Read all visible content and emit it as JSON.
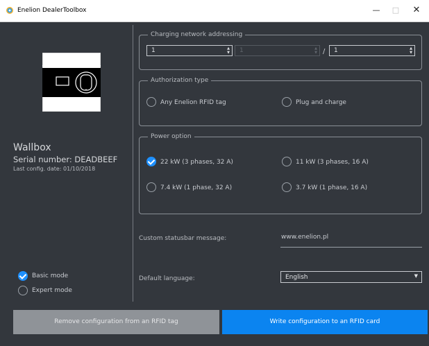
{
  "window": {
    "title": "Enelion DealerToolbox"
  },
  "device": {
    "name": "Wallbox",
    "serial": "Serial number: DEADBEEF",
    "last_config": "Last config. date: 01/10/2018"
  },
  "mode": {
    "basic": "Basic mode",
    "expert": "Expert mode",
    "selected": "basic"
  },
  "network": {
    "title": "Charging network addressing",
    "field1": "1",
    "field2": "1",
    "separator": "/",
    "field3": "1"
  },
  "authorization": {
    "title": "Authorization type",
    "options": [
      "Any Enelion RFID tag",
      "Plug and charge"
    ]
  },
  "power": {
    "title": "Power option",
    "options": [
      "22 kW (3 phases, 32 A)",
      "11 kW (3 phases, 16 A)",
      "7.4 kW (1 phase, 32 A)",
      "3.7 kW (1 phase, 16 A)"
    ],
    "selected": "22 kW (3 phases, 32 A)"
  },
  "statusbar": {
    "label": "Custom statusbar message:",
    "value": "www.enelion.pl"
  },
  "language": {
    "label": "Default language:",
    "value": "English"
  },
  "buttons": {
    "remove": "Remove configuration from an RFID tag",
    "write": "Write configuration to an RFID card"
  },
  "colors": {
    "accent": "#0b84f0",
    "background": "#33373d",
    "radio_checked": "#1e90ff"
  }
}
